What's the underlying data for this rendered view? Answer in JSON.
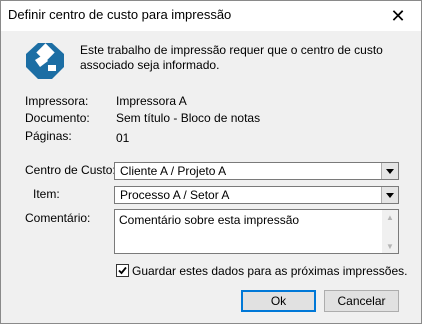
{
  "window": {
    "title": "Definir centro de custo para impressão"
  },
  "info": {
    "message": "Este trabalho de impressão requer que o centro de custo associado seja informado."
  },
  "details": {
    "printer_label": "Impressora:",
    "printer_value": "Impressora A",
    "document_label": "Documento:",
    "document_value": "Sem título - Bloco de notas",
    "pages_label": "Páginas:",
    "pages_value": "01"
  },
  "form": {
    "cost_center_label": "Centro de Custo:",
    "cost_center_value": "Cliente A / Projeto A",
    "item_label": "Item:",
    "item_value": "Processo A / Setor A",
    "comment_label": "Comentário:",
    "comment_value": "Comentário sobre esta impressão",
    "save_checkbox_label": "Guardar estes dados para as próximas impressões.",
    "save_checked": true
  },
  "buttons": {
    "ok": "Ok",
    "cancel": "Cancelar"
  },
  "colors": {
    "accent": "#0078d7",
    "icon": "#1c6ea4"
  }
}
